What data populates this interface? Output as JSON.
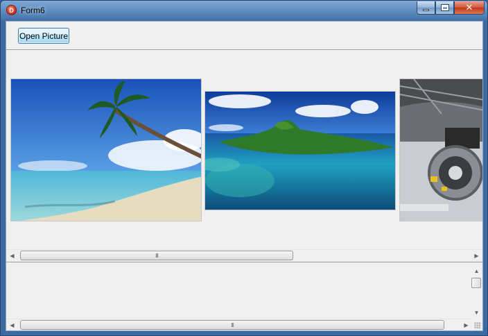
{
  "window": {
    "title": "Form6",
    "icon_letter": "D",
    "close_glyph": "✕"
  },
  "toolbar": {
    "open_picture_label": "Open Picture"
  },
  "scrollbars": {
    "left_arrow": "◀",
    "right_arrow": "▶",
    "up_arrow": "▲",
    "down_arrow": "▼",
    "thumb_grip": "III"
  },
  "colors": {
    "titlebar": "#4f7fb4",
    "client_bg": "#f0f0f0",
    "button_border": "#3c7fb1",
    "close_button": "#c23418"
  },
  "pictures": [
    {
      "name": "tropical-beach-with-palm-tree"
    },
    {
      "name": "green-island-in-turquoise-lagoon"
    },
    {
      "name": "industrial-machinery-tunnel"
    }
  ]
}
